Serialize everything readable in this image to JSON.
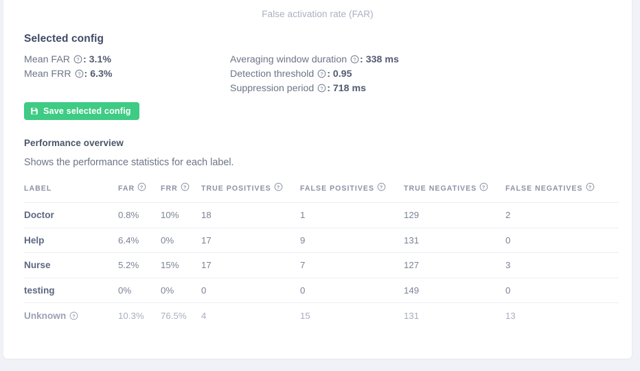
{
  "chart": {
    "caption": "False activation rate (FAR)"
  },
  "selected_config": {
    "title": "Selected config",
    "left_items": [
      {
        "label": "Mean FAR",
        "help": "?",
        "value": "3.1%"
      },
      {
        "label": "Mean FRR",
        "help": "?",
        "value": "6.3%"
      }
    ],
    "right_items": [
      {
        "label": "Averaging window duration",
        "help": "?",
        "value": "338 ms"
      },
      {
        "label": "Detection threshold",
        "help": "?",
        "value": "0.95"
      },
      {
        "label": "Suppression period",
        "help": "?",
        "value": "718 ms"
      }
    ],
    "save_button": {
      "label": "Save selected config",
      "icon": "save-icon",
      "color": "#3ecb84"
    }
  },
  "performance_overview": {
    "title": "Performance overview",
    "subtitle": "Shows the performance statistics for each label.",
    "table": {
      "columns": [
        {
          "key": "label",
          "label": "LABEL",
          "help": false
        },
        {
          "key": "far",
          "label": "FAR",
          "help": true
        },
        {
          "key": "frr",
          "label": "FRR",
          "help": true
        },
        {
          "key": "true_positives",
          "label": "TRUE POSITIVES",
          "help": true
        },
        {
          "key": "false_positives",
          "label": "FALSE POSITIVES",
          "help": true
        },
        {
          "key": "true_negatives",
          "label": "TRUE NEGATIVES",
          "help": true
        },
        {
          "key": "false_negatives",
          "label": "FALSE NEGATIVES",
          "help": true
        }
      ],
      "rows": [
        {
          "label": "Doctor",
          "label_help": false,
          "muted": false,
          "far": "0.8%",
          "frr": "10%",
          "true_positives": "18",
          "false_positives": "1",
          "true_negatives": "129",
          "false_negatives": "2"
        },
        {
          "label": "Help",
          "label_help": false,
          "muted": false,
          "far": "6.4%",
          "frr": "0%",
          "true_positives": "17",
          "false_positives": "9",
          "true_negatives": "131",
          "false_negatives": "0"
        },
        {
          "label": "Nurse",
          "label_help": false,
          "muted": false,
          "far": "5.2%",
          "frr": "15%",
          "true_positives": "17",
          "false_positives": "7",
          "true_negatives": "127",
          "false_negatives": "3"
        },
        {
          "label": "testing",
          "label_help": false,
          "muted": false,
          "far": "0%",
          "frr": "0%",
          "true_positives": "0",
          "false_positives": "0",
          "true_negatives": "149",
          "false_negatives": "0"
        },
        {
          "label": "Unknown",
          "label_help": true,
          "muted": true,
          "far": "10.3%",
          "frr": "76.5%",
          "true_positives": "4",
          "false_positives": "15",
          "true_negatives": "131",
          "false_negatives": "13"
        }
      ]
    }
  },
  "theme": {
    "page_background": "#f1f2f8",
    "card_background": "#ffffff",
    "accent_green": "#3ecb84",
    "text_primary": "#5d6781",
    "text_secondary": "#7b8295",
    "text_muted": "#a8aebf"
  }
}
